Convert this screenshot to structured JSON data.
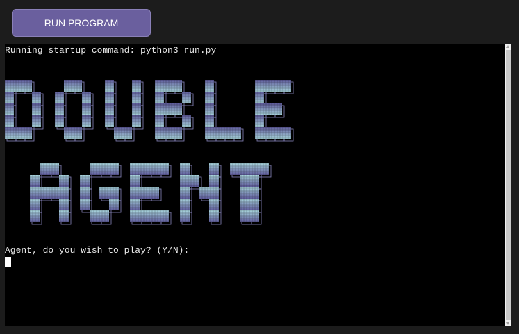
{
  "toolbar": {
    "run_label": "RUN PROGRAM"
  },
  "terminal": {
    "startup_line": "Running startup command: python3 run.py",
    "banner_icon": "double-agent-ascii-banner",
    "banner_word_1": "DOUBLE",
    "banner_word_2": "AGENT",
    "prompt_line": "Agent, do you wish to play? (Y/N):"
  },
  "colors": {
    "button": "#6a5f9e",
    "terminal_bg": "#000000",
    "banner_top": "#5e5a9a",
    "banner_bottom": "#a8d4dc"
  }
}
